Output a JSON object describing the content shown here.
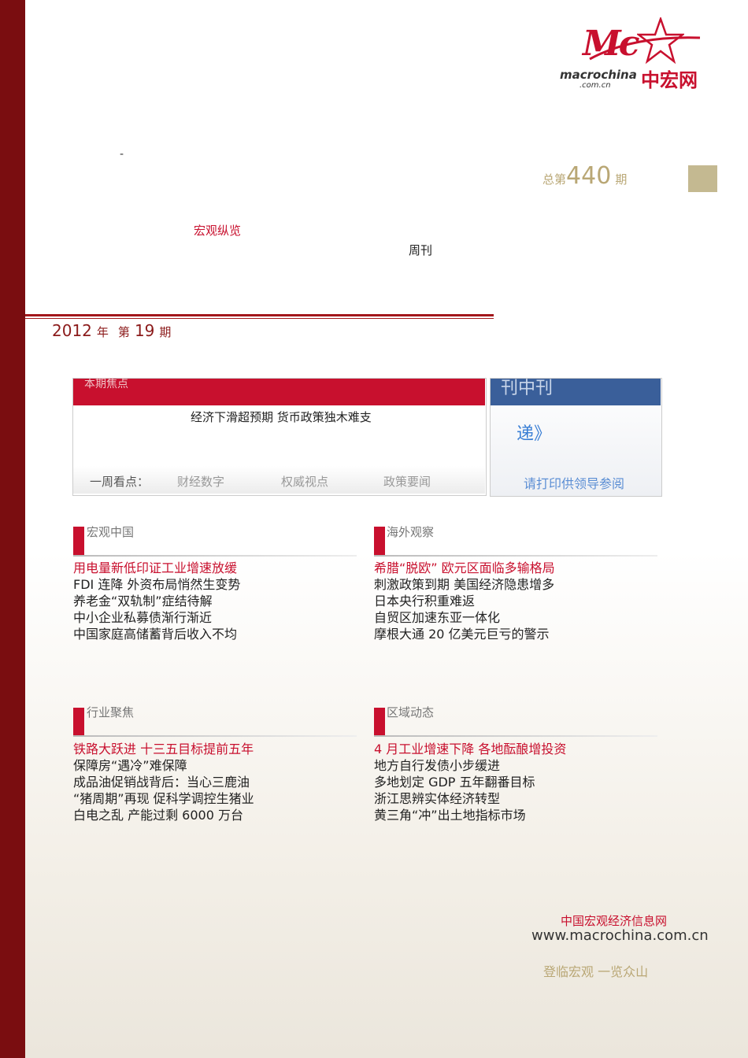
{
  "logo": {
    "mark": "Mc",
    "english": "macrochina",
    "domain": ".com.cn",
    "chinese": "中宏网"
  },
  "header": {
    "dash": "-",
    "total_prefix": "总第",
    "total_number": "440",
    "total_suffix": "期",
    "magazine_name": "宏观纵览",
    "periodical": "周刊"
  },
  "issue_line": {
    "year": "2012",
    "year_char": "年",
    "ordinal_char": "第",
    "number": "19",
    "issue_char": "期"
  },
  "focus": {
    "label": "本期焦点",
    "headline": "经济下滑超预期 货币政策独木难支",
    "weekly_label": "一周看点：",
    "weekly_items": [
      "财经数字",
      "权威视点",
      "政策要闻"
    ]
  },
  "sidebox": {
    "label": "刊中刊",
    "arrow": "递》",
    "note": "请打印供领导参阅"
  },
  "sections": [
    {
      "title": "宏观中国",
      "articles": [
        "用电量新低印证工业增速放缓",
        "FDI 连降 外资布局悄然生变势",
        "养老金“双轨制”症结待解",
        "中小企业私募债渐行渐近",
        "中国家庭高储蓄背后收入不均"
      ]
    },
    {
      "title": "海外观察",
      "articles": [
        "希腊“脱欧” 欧元区面临多输格局",
        "刺激政策到期 美国经济隐患增多",
        "日本央行积重难返",
        "自贸区加速东亚一体化",
        "摩根大通 20 亿美元巨亏的警示"
      ]
    },
    {
      "title": "行业聚焦",
      "articles": [
        "铁路大跃进 十三五目标提前五年",
        "保障房“遇冷”难保障",
        "成品油促销战背后：当心三鹿油",
        "“猪周期”再现 促科学调控生猪业",
        "白电之乱 产能过剩 6000 万台"
      ]
    },
    {
      "title": "区域动态",
      "articles": [
        "4 月工业增速下降 各地酝酿增投资",
        "地方自行发债小步缓进",
        "多地划定 GDP 五年翻番目标",
        "浙江思辨实体经济转型",
        "黄三角“冲”出土地指标市场"
      ]
    }
  ],
  "footer": {
    "site_name": "中国宏观经济信息网",
    "url": "www.macrochina.com.cn",
    "slogan": "登临宏观 一览众山"
  },
  "colors": {
    "maroon": "#7a0d10",
    "red": "#c8102e",
    "gold": "#b9a775",
    "blue": "#3a5f9a"
  }
}
